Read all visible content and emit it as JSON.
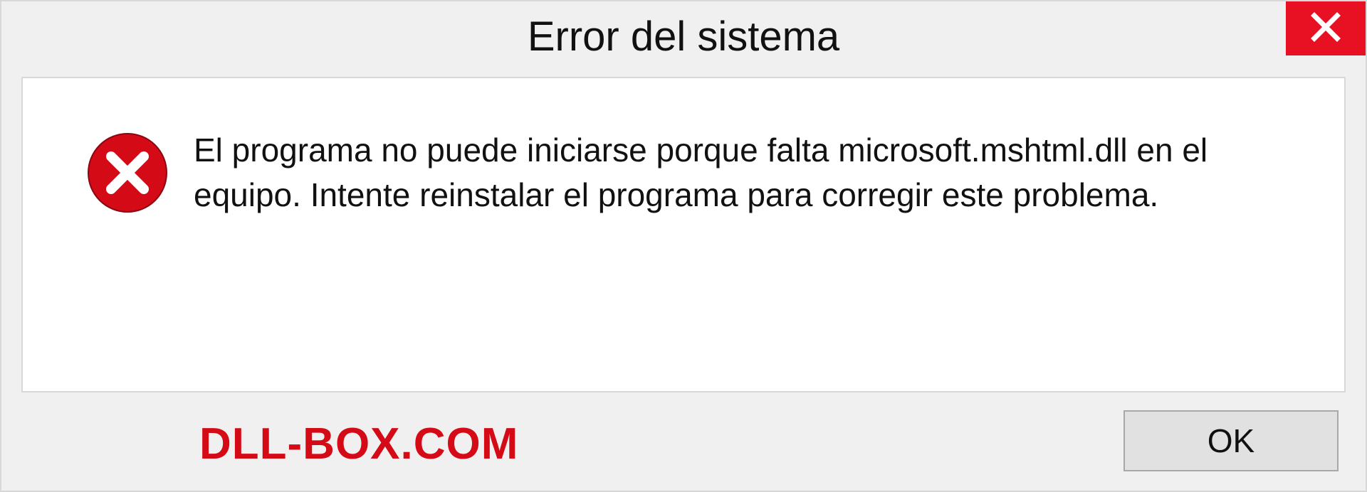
{
  "titlebar": {
    "title": "Error del sistema"
  },
  "content": {
    "message": "El programa no puede iniciarse porque falta microsoft.mshtml.dll en el equipo. Intente reinstalar el programa para corregir este problema."
  },
  "footer": {
    "watermark": "DLL-BOX.COM",
    "ok_label": "OK"
  },
  "colors": {
    "close_bg": "#e81123",
    "error_icon": "#d40a17",
    "watermark": "#d40a17"
  }
}
